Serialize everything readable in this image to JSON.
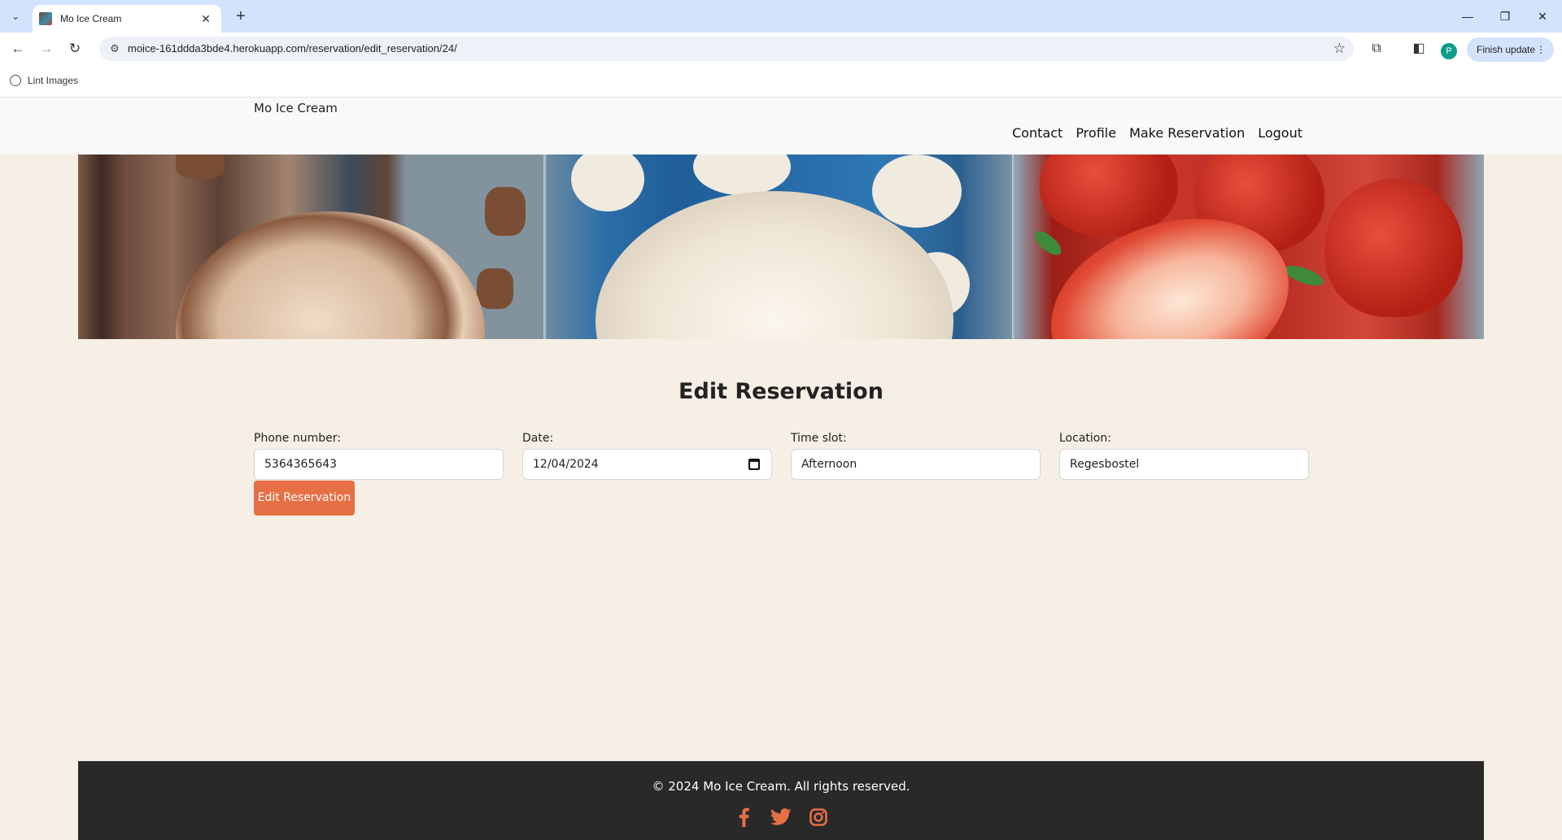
{
  "browser": {
    "tab_title": "Mo Ice Cream",
    "url": "moice-161ddda3bde4.herokuapp.com/reservation/edit_reservation/24/",
    "profile_initial": "P",
    "finish_update_label": "Finish update",
    "bookmark_label": "Lint Images"
  },
  "nav": {
    "brand": "Mo Ice Cream",
    "links": [
      "Contact",
      "Profile",
      "Make Reservation",
      "Logout"
    ]
  },
  "form": {
    "title": "Edit Reservation",
    "fields": [
      {
        "label": "Phone number:",
        "value": "5364365643"
      },
      {
        "label": "Date:",
        "value": "12/04/2024"
      },
      {
        "label": "Time slot:",
        "value": "Afternoon"
      },
      {
        "label": "Location:",
        "value": "Regesbostel"
      }
    ],
    "submit_label": "Edit Reservation"
  },
  "footer": {
    "copyright": "© 2024 Mo Ice Cream. All rights reserved.",
    "social_icons": [
      "facebook-icon",
      "twitter-icon",
      "instagram-icon"
    ],
    "accent_color": "#e76f45"
  },
  "colors": {
    "page_bg": "#f6efe6",
    "button_bg": "#e76f45",
    "footer_bg": "#292929",
    "tabstrip_bg": "#d3e3fd"
  }
}
